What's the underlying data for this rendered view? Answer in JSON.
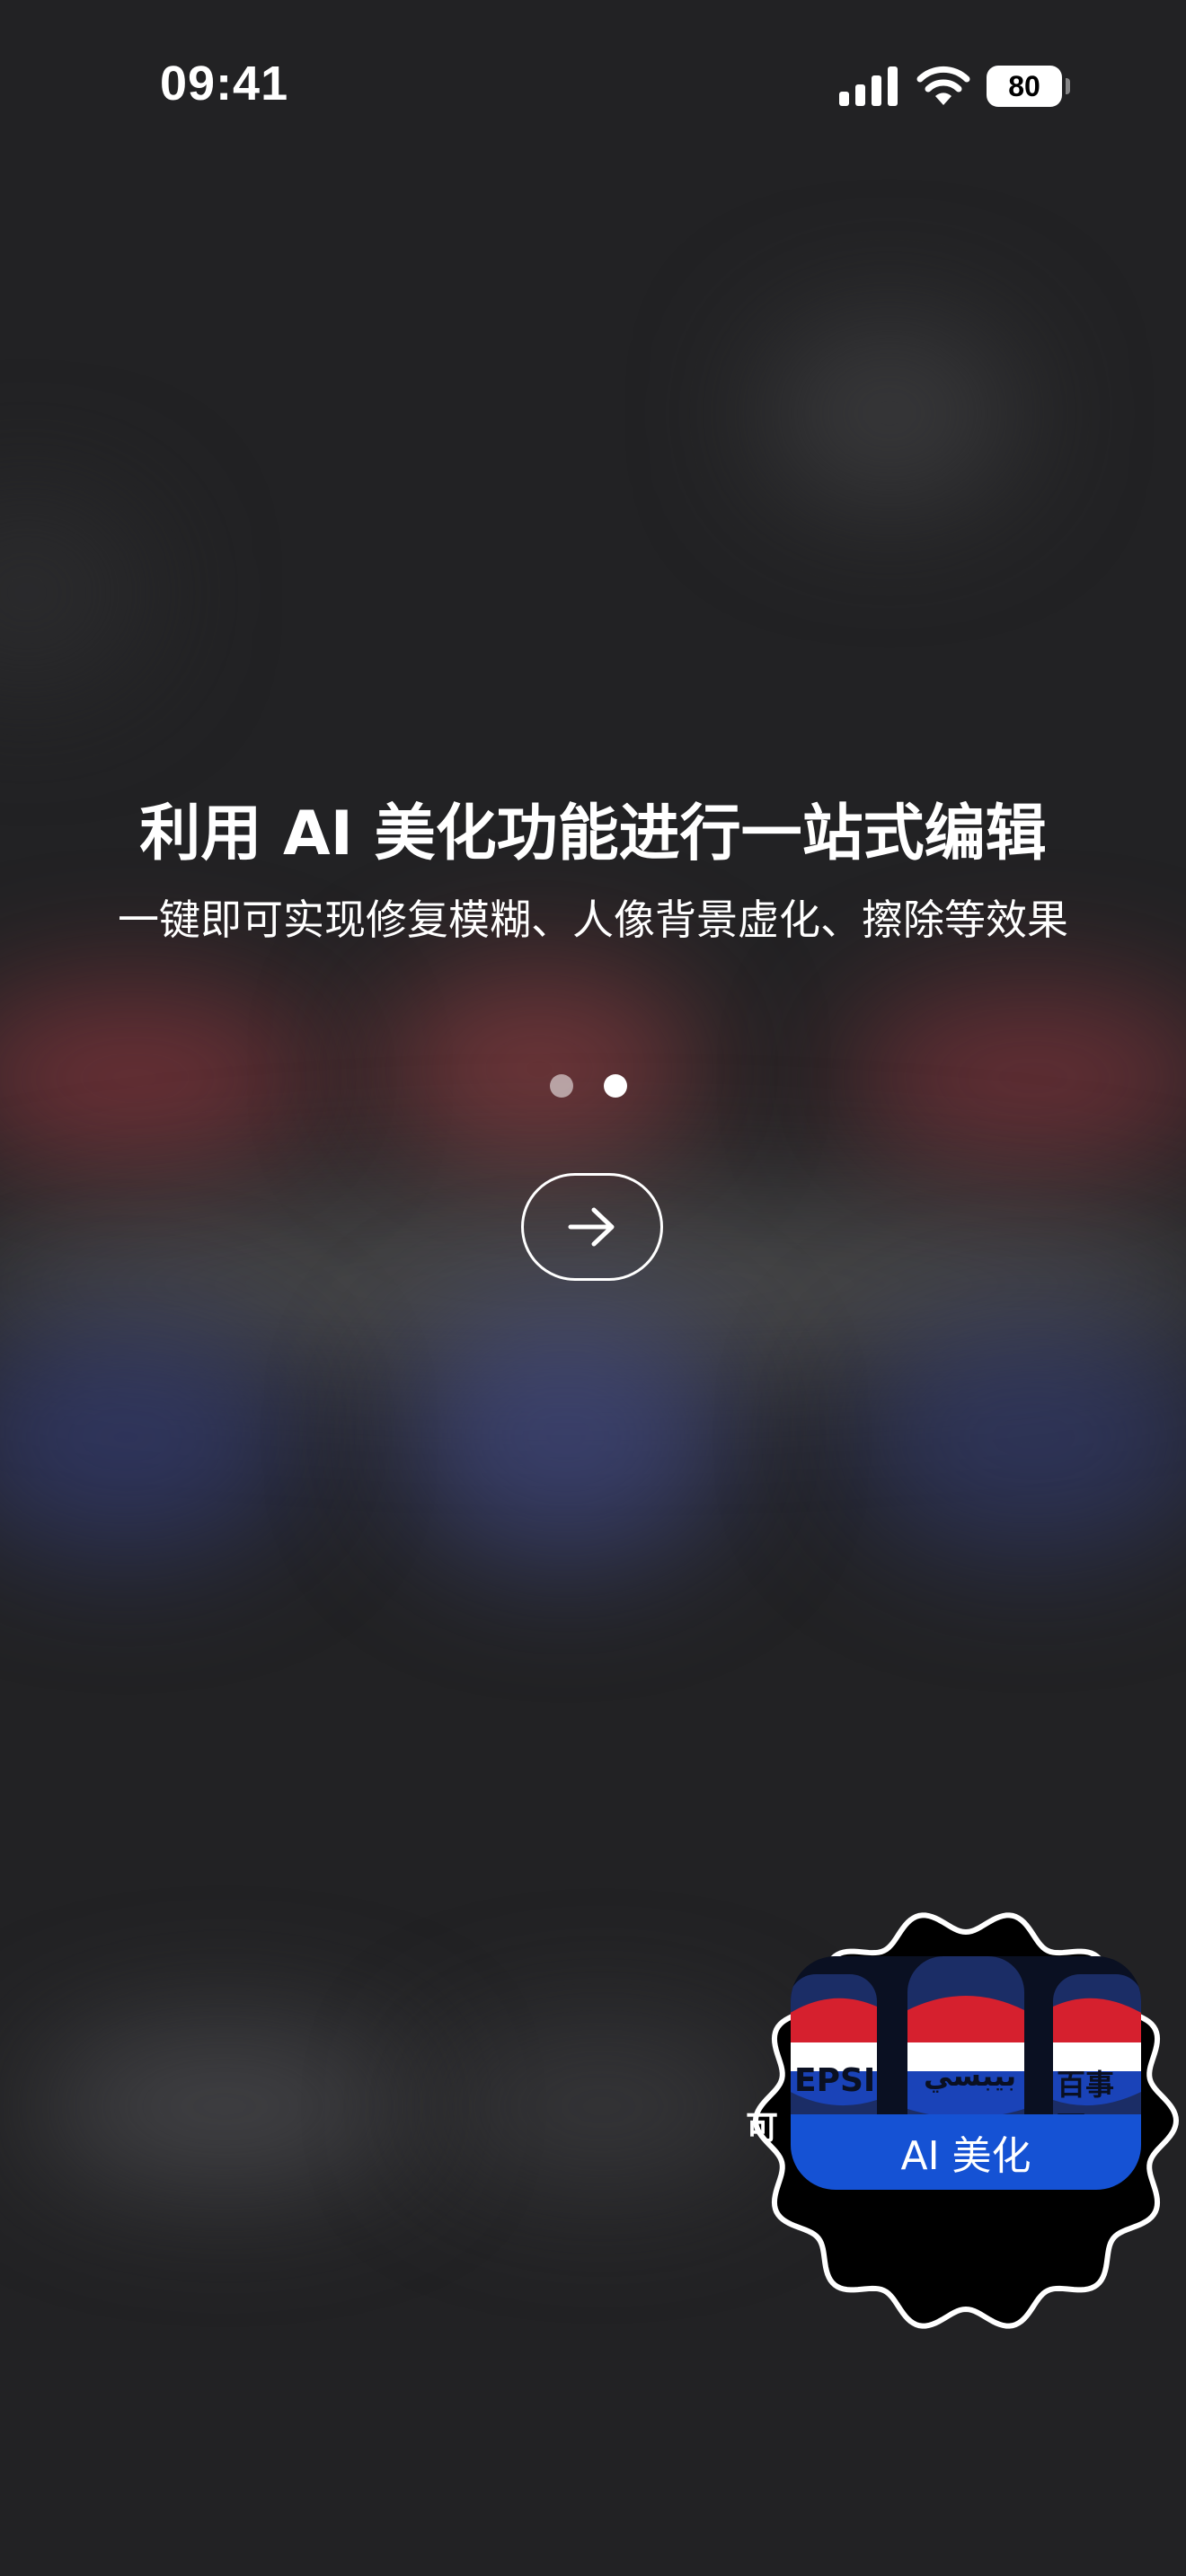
{
  "status_bar": {
    "time": "09:41",
    "battery": "80"
  },
  "onboarding": {
    "title": "利用 AI 美化功能进行一站式编辑",
    "subtitle": "一键即可实现修复模糊、人像背景虚化、擦除等效果",
    "page_count": 2,
    "current_page": 2
  },
  "badge": {
    "label": "AI 美化",
    "image_text": {
      "left": "可",
      "can_left": "EPSI",
      "can_middle": "بيبسي",
      "can_right": "百事可"
    }
  },
  "colors": {
    "background": "#222224",
    "badge_bar": "#1552d4",
    "text": "#ffffff"
  }
}
